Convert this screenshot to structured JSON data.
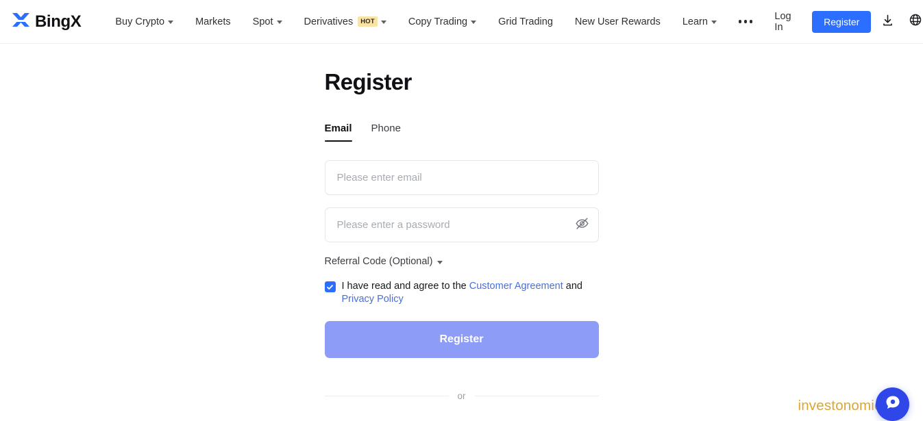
{
  "brand": {
    "name": "BingX",
    "logo_icon": "bingx-x-logo",
    "logo_color": "#2c6eff"
  },
  "nav": {
    "items": [
      {
        "label": "Buy Crypto",
        "has_caret": true,
        "badge": null
      },
      {
        "label": "Markets",
        "has_caret": false,
        "badge": null
      },
      {
        "label": "Spot",
        "has_caret": true,
        "badge": null
      },
      {
        "label": "Derivatives",
        "has_caret": true,
        "badge": "HOT"
      },
      {
        "label": "Copy Trading",
        "has_caret": true,
        "badge": null
      },
      {
        "label": "Grid Trading",
        "has_caret": false,
        "badge": null
      },
      {
        "label": "New User Rewards",
        "has_caret": false,
        "badge": null
      },
      {
        "label": "Learn",
        "has_caret": true,
        "badge": null
      }
    ],
    "more_icon": "ellipsis-icon",
    "login_label": "Log In",
    "register_label": "Register",
    "download_icon": "download-icon",
    "language_icon": "globe-icon",
    "register_button_color": "#2c6eff",
    "hot_badge_color": "#fbe3a6"
  },
  "main": {
    "title": "Register",
    "tabs": [
      {
        "label": "Email",
        "active": true
      },
      {
        "label": "Phone",
        "active": false
      }
    ],
    "email_field": {
      "placeholder": "Please enter email",
      "value": ""
    },
    "password_field": {
      "placeholder": "Please enter a password",
      "value": "",
      "toggle_icon": "eye-off-icon"
    },
    "referral": {
      "label": "Referral Code (Optional)",
      "icon": "chevron-down-icon"
    },
    "agreement": {
      "checked": true,
      "prefix": "I have read and agree to the",
      "link1": "Customer Agreement",
      "conjunction": "and",
      "link2": "Privacy Policy",
      "link_color": "#4b6fd6",
      "checkbox_color": "#2c6eff"
    },
    "submit_label": "Register",
    "submit_color": "#8d9cf7",
    "divider_label": "or"
  },
  "overlay": {
    "watermark": "investonomic.ru",
    "watermark_color": "#d9a63a",
    "chat_icon": "chat-bubble-icon",
    "chat_color": "#2f46e8"
  }
}
